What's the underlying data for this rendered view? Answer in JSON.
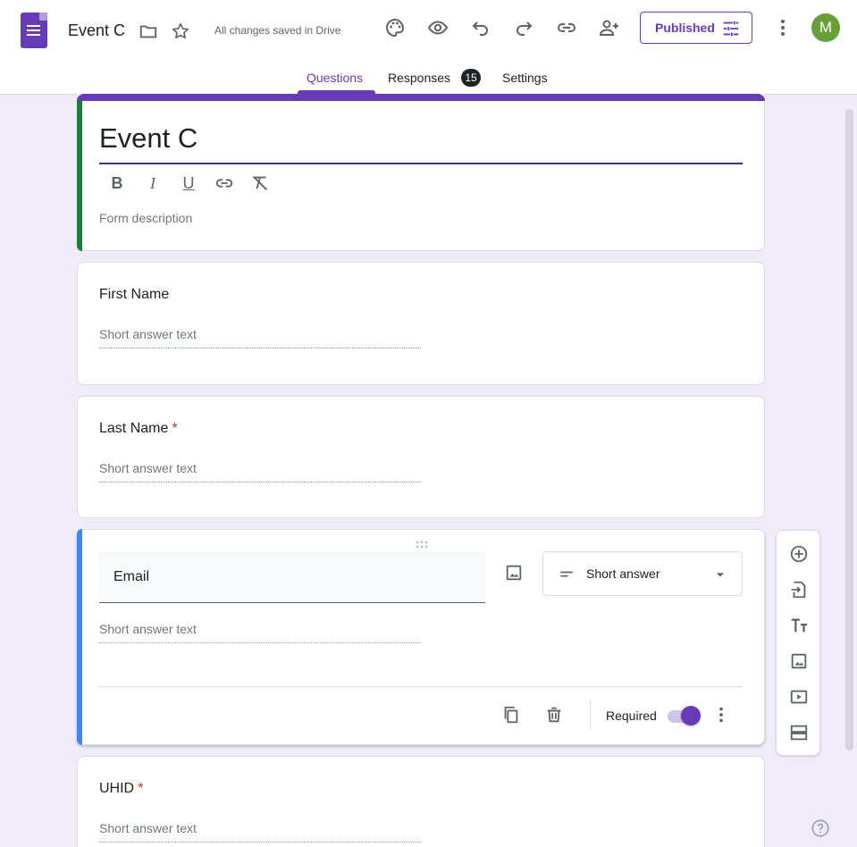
{
  "header": {
    "title": "Event C",
    "save_status": "All changes saved in Drive",
    "publish_label": "Published",
    "avatar_letter": "M"
  },
  "tabs": [
    {
      "label": "Questions",
      "active": true
    },
    {
      "label": "Responses",
      "badge": "15"
    },
    {
      "label": "Settings"
    }
  ],
  "form": {
    "title": "Event C",
    "description_placeholder": "Form description"
  },
  "questions": [
    {
      "label": "First Name",
      "required": false,
      "placeholder": "Short answer text"
    },
    {
      "label": "Last Name",
      "required": true,
      "star": "*",
      "placeholder": "Short answer text"
    },
    {
      "label": "Email",
      "required": true,
      "placeholder": "Short answer text",
      "type": "Short answer",
      "required_label": "Required"
    },
    {
      "label": "UHID",
      "required": true,
      "star": "*",
      "placeholder": "Short answer text"
    }
  ],
  "colors": {
    "accent": "#673ab7",
    "title_card_bar": "#188038",
    "active_card_bar": "#4285f4",
    "required_star": "#d93025"
  }
}
